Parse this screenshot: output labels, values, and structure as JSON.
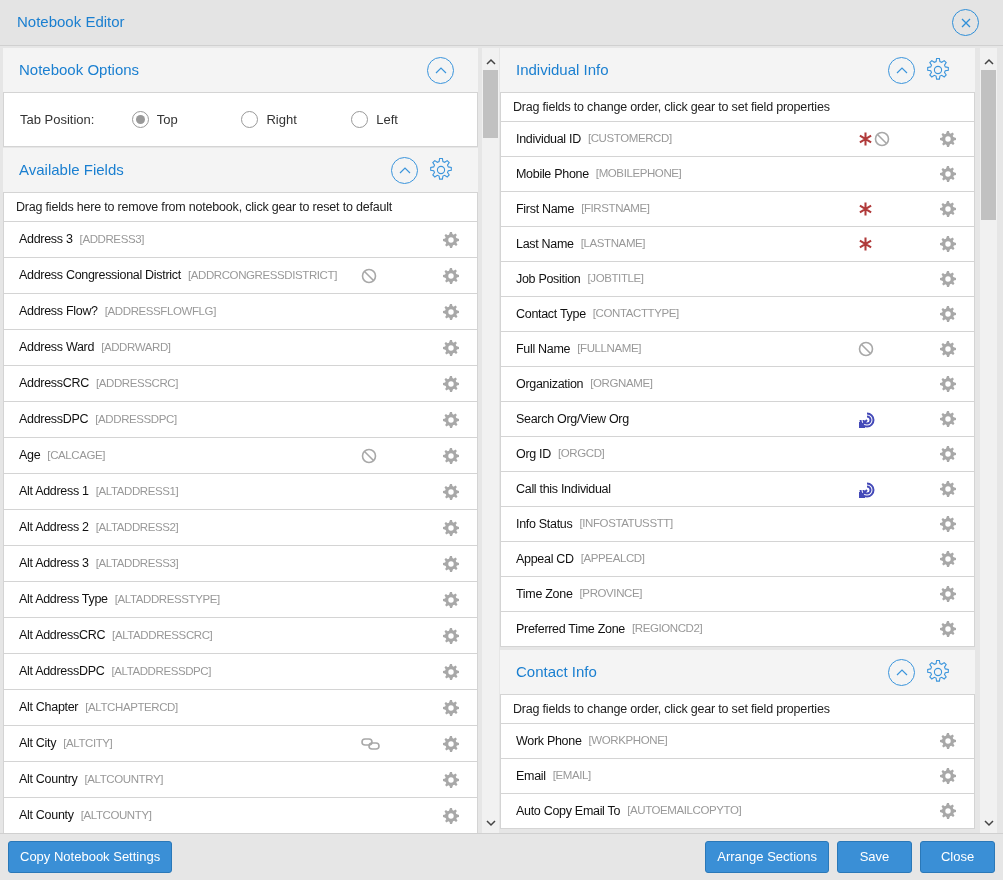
{
  "window": {
    "title": "Notebook Editor"
  },
  "notebook_options": {
    "title": "Notebook Options",
    "tab_position": {
      "label": "Tab Position:",
      "options": [
        {
          "label": "Top",
          "selected": true
        },
        {
          "label": "Right",
          "selected": false
        },
        {
          "label": "Left",
          "selected": false
        }
      ]
    }
  },
  "available_fields": {
    "title": "Available Fields",
    "hint": "Drag fields here to remove from notebook, click gear to reset to default",
    "fields": [
      {
        "label": "Address 3",
        "code": "[ADDRESS3]"
      },
      {
        "label": "Address Congressional District",
        "code": "[ADDRCONGRESSDISTRICT]",
        "badges": [
          {
            "kind": "blocked"
          }
        ]
      },
      {
        "label": "Address Flow?",
        "code": "[ADDRESSFLOWFLG]"
      },
      {
        "label": "Address Ward",
        "code": "[ADDRWARD]"
      },
      {
        "label": "AddressCRC",
        "code": "[ADDRESSCRC]"
      },
      {
        "label": "AddressDPC",
        "code": "[ADDRESSDPC]"
      },
      {
        "label": "Age",
        "code": "[CALCAGE]",
        "badges": [
          {
            "kind": "blocked"
          }
        ]
      },
      {
        "label": "Alt Address 1",
        "code": "[ALTADDRESS1]"
      },
      {
        "label": "Alt Address 2",
        "code": "[ALTADDRESS2]"
      },
      {
        "label": "Alt Address 3",
        "code": "[ALTADDRESS3]"
      },
      {
        "label": "Alt Address Type",
        "code": "[ALTADDRESSTYPE]"
      },
      {
        "label": "Alt AddressCRC",
        "code": "[ALTADDRESSCRC]"
      },
      {
        "label": "Alt AddressDPC",
        "code": "[ALTADDRESSDPC]"
      },
      {
        "label": "Alt Chapter",
        "code": "[ALTCHAPTERCD]"
      },
      {
        "label": "Alt City",
        "code": "[ALTCITY]",
        "badges": [
          {
            "kind": "linked"
          }
        ]
      },
      {
        "label": "Alt Country",
        "code": "[ALTCOUNTRY]"
      },
      {
        "label": "Alt County",
        "code": "[ALTCOUNTY]"
      }
    ]
  },
  "sections": [
    {
      "title": "Individual Info",
      "hint": "Drag fields to change order, click gear to set field properties",
      "fields": [
        {
          "label": "Individual ID",
          "code": "[CUSTOMERCD]",
          "badges": [
            {
              "kind": "required"
            },
            {
              "kind": "blocked"
            }
          ]
        },
        {
          "label": "Mobile Phone",
          "code": "[MOBILEPHONE]"
        },
        {
          "label": "First Name",
          "code": "[FIRSTNAME]",
          "badges": [
            {
              "kind": "required"
            }
          ]
        },
        {
          "label": "Last Name",
          "code": "[LASTNAME]",
          "badges": [
            {
              "kind": "required"
            }
          ]
        },
        {
          "label": "Job Position",
          "code": "[JOBTITLE]"
        },
        {
          "label": "Contact Type",
          "code": "[CONTACTTYPE]"
        },
        {
          "label": "Full Name",
          "code": "[FULLNAME]",
          "badges": [
            {
              "kind": "blocked"
            }
          ]
        },
        {
          "label": "Organization",
          "code": "[ORGNAME]"
        },
        {
          "label": "Search Org/View Org",
          "badges": [
            {
              "kind": "action"
            }
          ]
        },
        {
          "label": "Org ID",
          "code": "[ORGCD]"
        },
        {
          "label": "Call this Individual",
          "badges": [
            {
              "kind": "action"
            }
          ]
        },
        {
          "label": "Info Status",
          "code": "[INFOSTATUSSTT]"
        },
        {
          "label": "Appeal CD",
          "code": "[APPEALCD]"
        },
        {
          "label": "Time Zone",
          "code": "[PROVINCE]"
        },
        {
          "label": "Preferred Time Zone",
          "code": "[REGIONCD2]"
        }
      ]
    },
    {
      "title": "Contact Info",
      "hint": "Drag fields to change order, click gear to set field properties",
      "fields": [
        {
          "label": "Work Phone",
          "code": "[WORKPHONE]"
        },
        {
          "label": "Email",
          "code": "[EMAIL]"
        },
        {
          "label": "Auto Copy Email To",
          "code": "[AUTOEMAILCOPYTO]"
        }
      ]
    }
  ],
  "footer": {
    "left_buttons": [
      "Copy Notebook Settings"
    ],
    "right_buttons": [
      "Arrange Sections",
      "Save",
      "Close"
    ]
  }
}
